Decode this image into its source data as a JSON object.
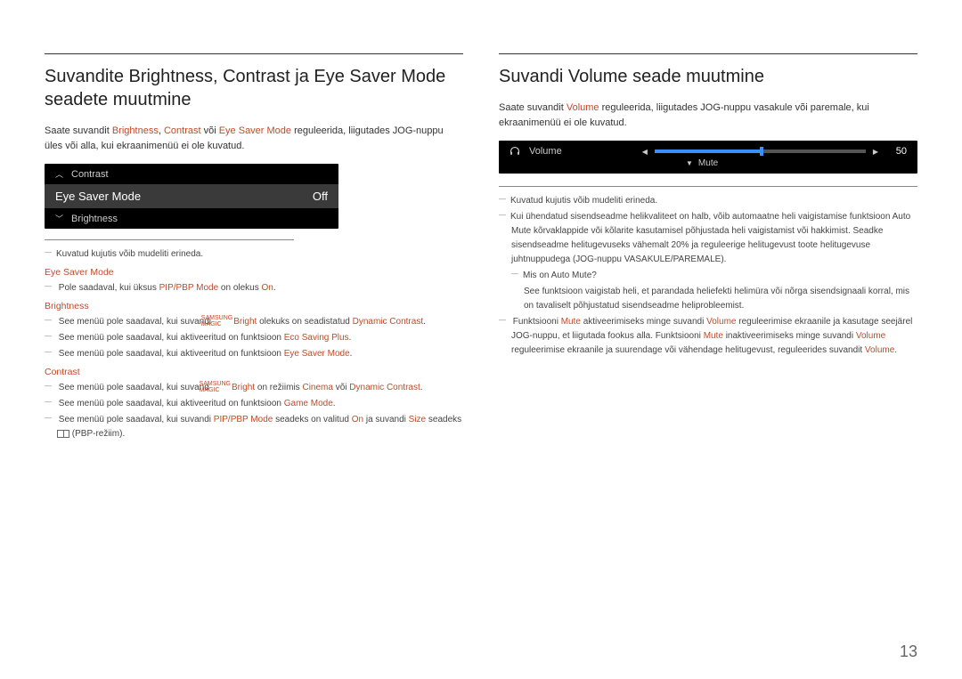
{
  "left": {
    "heading": "Suvandite Brightness, Contrast ja Eye Saver Mode seadete muutmine",
    "intro_parts": [
      "Saate suvandit ",
      "Brightness",
      ", ",
      "Contrast",
      " või ",
      "Eye Saver Mode",
      " reguleerida, liigutades JOG-nuppu üles või alla, kui ekraanimenüü ei ole kuvatud."
    ],
    "osd": {
      "up": "Contrast",
      "current": "Eye Saver Mode",
      "value": "Off",
      "down": "Brightness"
    },
    "disclaimer": "Kuvatud kujutis võib mudeliti erineda.",
    "sec1_title": "Eye Saver Mode",
    "sec1_n1_a": "Pole saadaval, kui üksus ",
    "sec1_n1_b": "PIP/PBP Mode",
    "sec1_n1_c": " on olekus ",
    "sec1_n1_d": "On",
    "sec1_n1_e": ".",
    "sec2_title": "Brightness",
    "sec2_n1_a": "See menüü pole saadaval, kui suvandi ",
    "sec2_n1_b": "Bright",
    "sec2_n1_c": " olekuks on seadistatud ",
    "sec2_n1_d": "Dynamic Contrast",
    "sec2_n1_e": ".",
    "sec2_n2_a": "See menüü pole saadaval, kui aktiveeritud on funktsioon ",
    "sec2_n2_b": "Eco Saving Plus",
    "sec2_n2_c": ".",
    "sec2_n3_a": "See menüü pole saadaval, kui aktiveeritud on funktsioon ",
    "sec2_n3_b": "Eye Saver Mode",
    "sec2_n3_c": ".",
    "sec3_title": "Contrast",
    "sec3_n1_a": "See menüü pole saadaval, kui suvand ",
    "sec3_n1_b": "Bright",
    "sec3_n1_c": " on režiimis ",
    "sec3_n1_d": "Cinema",
    "sec3_n1_e": " või ",
    "sec3_n1_f": "Dynamic Contrast",
    "sec3_n1_g": ".",
    "sec3_n2_a": "See menüü pole saadaval, kui aktiveeritud on funktsioon ",
    "sec3_n2_b": "Game Mode",
    "sec3_n2_c": ".",
    "sec3_n3_a": "See menüü pole saadaval, kui suvandi ",
    "sec3_n3_b": "PIP/PBP Mode",
    "sec3_n3_c": " seadeks on valitud ",
    "sec3_n3_d": "On",
    "sec3_n3_e": " ja suvandi ",
    "sec3_n3_f": "Size",
    "sec3_n3_g": " seadeks ",
    "sec3_n3_h": " (PBP-režiim)."
  },
  "right": {
    "heading": "Suvandi Volume seade muutmine",
    "intro_a": "Saate suvandit ",
    "intro_b": "Volume",
    "intro_c": " reguleerida, liigutades JOG-nuppu vasakule või paremale, kui ekraanimenüü ei ole kuvatud.",
    "osd": {
      "volume_label": "Volume",
      "volume_value": "50",
      "mute_label": "Mute"
    },
    "disclaimer": "Kuvatud kujutis võib mudeliti erineda.",
    "n1": "Kui ühendatud sisendseadme helikvaliteet on halb, võib automaatne heli vaigistamise funktsioon Auto Mute kõrvaklappide või kõlarite kasutamisel põhjustada heli vaigistamist või hakkimist. Seadke sisendseadme helitugevuseks vähemalt 20% ja reguleerige helitugevust toote helitugevuse juhtnuppudega (JOG-nuppu VASAKULE/PAREMALE).",
    "n1a": "Mis on Auto Mute?",
    "n1b": "See funktsioon vaigistab heli, et parandada heliefekti helimüra või nõrga sisendsignaali korral, mis on tavaliselt põhjustatud sisendseadme heliprobleemist.",
    "n2_a": "Funktsiooni ",
    "n2_b": "Mute",
    "n2_c": " aktiveerimiseks minge suvandi ",
    "n2_d": "Volume",
    "n2_e": " reguleerimise ekraanile ja kasutage seejärel JOG-nuppu, et liigutada fookus alla. Funktsiooni ",
    "n2_f": "Mute",
    "n2_g": " inaktiveerimiseks minge suvandi ",
    "n2_h": "Volume",
    "n2_i": " reguleerimise ekraanile ja suurendage või vähendage helitugevust, reguleerides suvandit ",
    "n2_j": "Volume",
    "n2_k": "."
  },
  "page_number": "13",
  "magic_top": "SAMSUNG",
  "magic_bot": "MAGIC"
}
